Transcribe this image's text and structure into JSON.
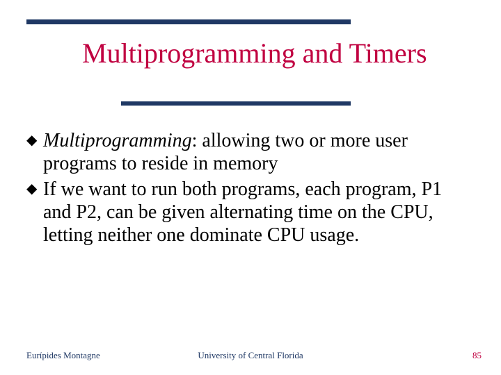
{
  "title": "Multiprogramming and Timers",
  "bullets": [
    {
      "term": "Multiprogramming",
      "rest": ":  allowing two or more user programs to reside in memory"
    },
    {
      "full": "If we want to run both programs, each program, P1 and P2, can be given alternating time on the CPU, letting neither one dominate CPU usage."
    }
  ],
  "footer": {
    "author": "Eurípides Montagne",
    "org": "University of Central Florida",
    "page": "85"
  },
  "colors": {
    "accent_rule": "#1f3864",
    "title": "#c00040",
    "page": "#c00040"
  }
}
